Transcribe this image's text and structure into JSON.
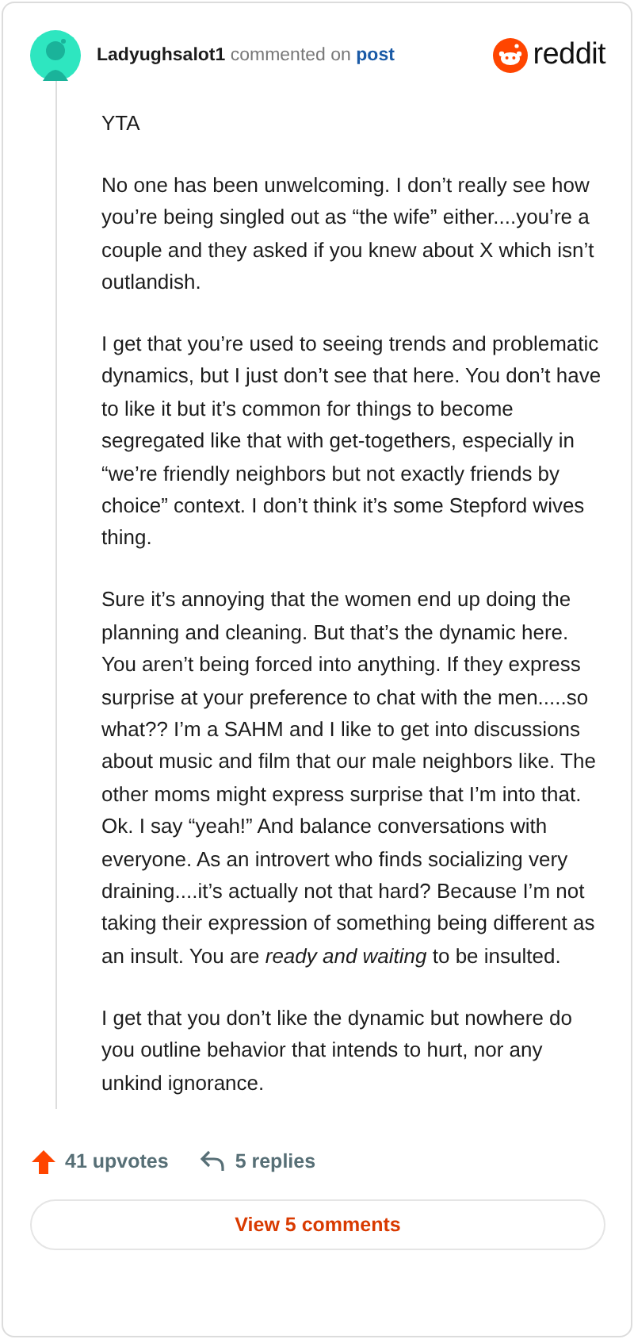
{
  "comment": {
    "author": "Ladyughsalot1",
    "action": "commented on",
    "link": "post",
    "brand": "reddit",
    "paragraphs": [
      "YTA",
      "No one has been unwelcoming. I don’t really see how you’re being singled out as “the wife” either....you’re a couple and they asked if you knew about X which isn’t outlandish.",
      "I get that you’re used to seeing trends and problematic dynamics, but I just don’t see that here. You don’t have to like it but it’s common for things to become segregated like that with get-togethers, especially in “we’re friendly neighbors but not exactly friends by choice” context. I don’t think it’s some Stepford wives thing.",
      "Sure it’s annoying that the women end up doing the planning and cleaning. But that’s the dynamic here. You aren’t being forced into anything. If they express surprise at your preference to chat with the men.....so what?? I’m a SAHM and I like to get into discussions about music and film that our male neighbors like. The other moms might express surprise that I’m into that. Ok. I say “yeah!” And balance conversations with everyone. As an introvert who finds socializing very draining....it’s actually not that hard? Because I’m not taking their expression of something being different as an insult. You are *ready and waiting* to be insulted.",
      "I get that you don’t like the dynamic but nowhere do you outline behavior that intends to hurt, nor any unkind ignorance."
    ],
    "upvotes": "41 upvotes",
    "replies": "5 replies",
    "view_button": "View 5 comments"
  }
}
